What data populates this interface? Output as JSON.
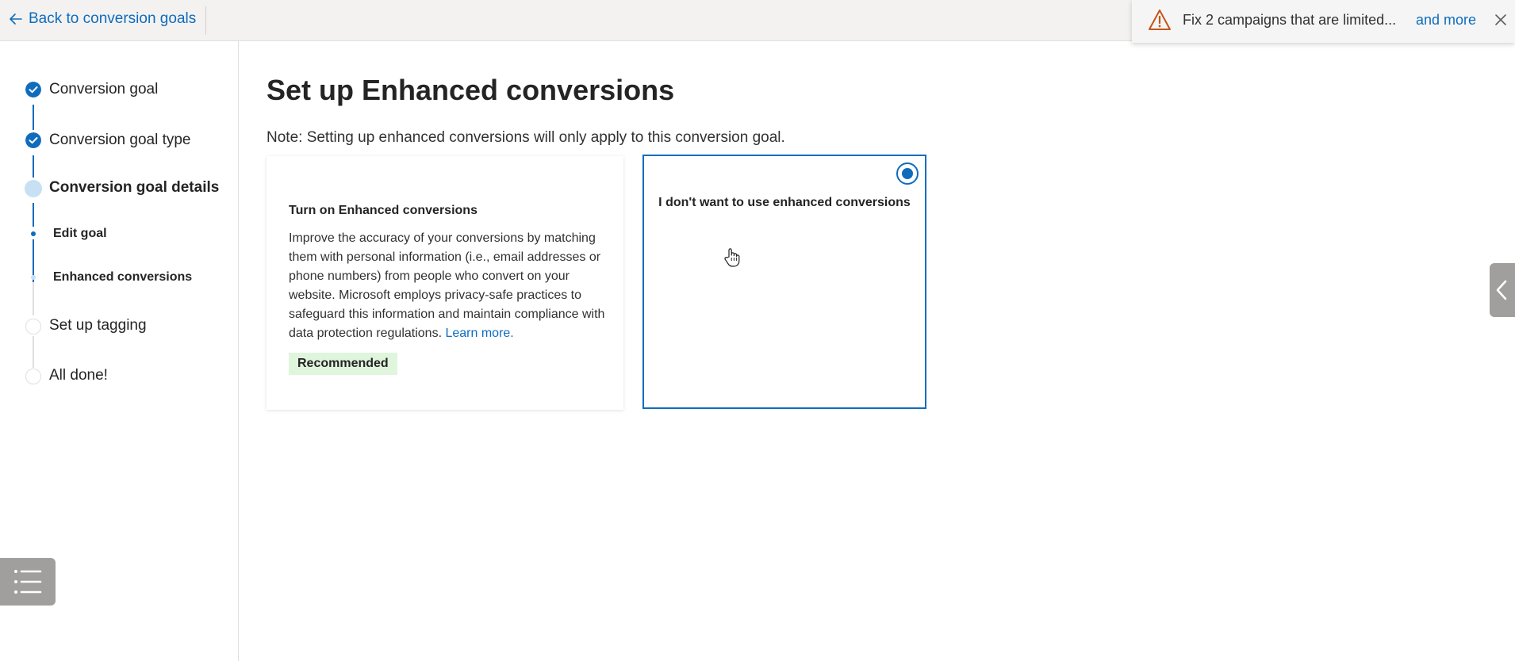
{
  "topbar": {
    "back_label": "Back to conversion goals"
  },
  "alert": {
    "message": "Fix 2 campaigns that are limited...",
    "more_label": "and more",
    "icon": "warning-icon",
    "close_icon": "close-icon"
  },
  "stepper": {
    "steps": [
      {
        "label": "Conversion goal",
        "state": "completed"
      },
      {
        "label": "Conversion goal type",
        "state": "completed"
      },
      {
        "label": "Conversion goal details",
        "state": "current"
      },
      {
        "label": "Edit goal",
        "state": "substep-done"
      },
      {
        "label": "Enhanced conversions",
        "state": "substep-current"
      },
      {
        "label": "Set up tagging",
        "state": "pending"
      },
      {
        "label": "All done!",
        "state": "pending"
      }
    ]
  },
  "main": {
    "title": "Set up Enhanced conversions",
    "note": "Note: Setting up enhanced conversions will only apply to this conversion goal.",
    "options": [
      {
        "title": "Turn on Enhanced conversions",
        "description": "Improve the accuracy of your conversions by matching them with personal information (i.e., email addresses or phone numbers) from people who convert on your website. Microsoft employs privacy-safe practices to safeguard this information and maintain compliance with data protection regulations.",
        "link": "Learn more.",
        "badge": "Recommended",
        "selected": false
      },
      {
        "title": "I don't want to use enhanced conversions",
        "selected": true
      }
    ]
  },
  "colors": {
    "accent": "#0f6cbd",
    "recommended_bg": "#dff6dd",
    "warning": "#c4561b"
  }
}
